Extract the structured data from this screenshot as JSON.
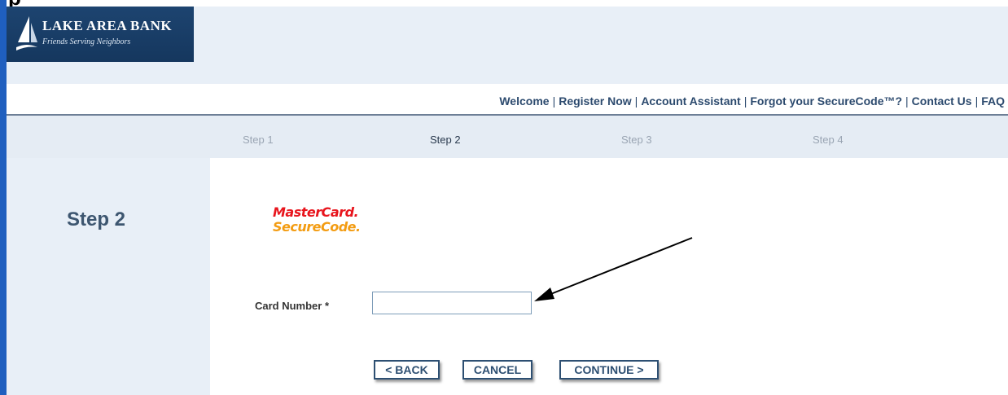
{
  "clipped_title": "p",
  "logo": {
    "name": "LAKE AREA BANK",
    "tagline": "Friends Serving Neighbors"
  },
  "top_nav": {
    "links": [
      "Welcome",
      "Register Now",
      "Account Assistant",
      "Forgot your SecureCode™?",
      "Contact Us",
      "FAQ"
    ],
    "separator": "|"
  },
  "steps": [
    "Step 1",
    "Step 2",
    "Step 3",
    "Step 4"
  ],
  "active_step": "Step 2",
  "panel_title": "Step 2",
  "brand": {
    "line1": "MasterCard.",
    "line2": "SecureCode."
  },
  "form": {
    "card_number_label": "Card Number *",
    "card_number_value": ""
  },
  "buttons": {
    "back": "< BACK",
    "cancel": "CANCEL",
    "continue": "CONTINUE >"
  },
  "colors": {
    "accent": "#2d4f72",
    "mastercard_red": "#e8151d",
    "securecode_orange": "#f39c12"
  }
}
